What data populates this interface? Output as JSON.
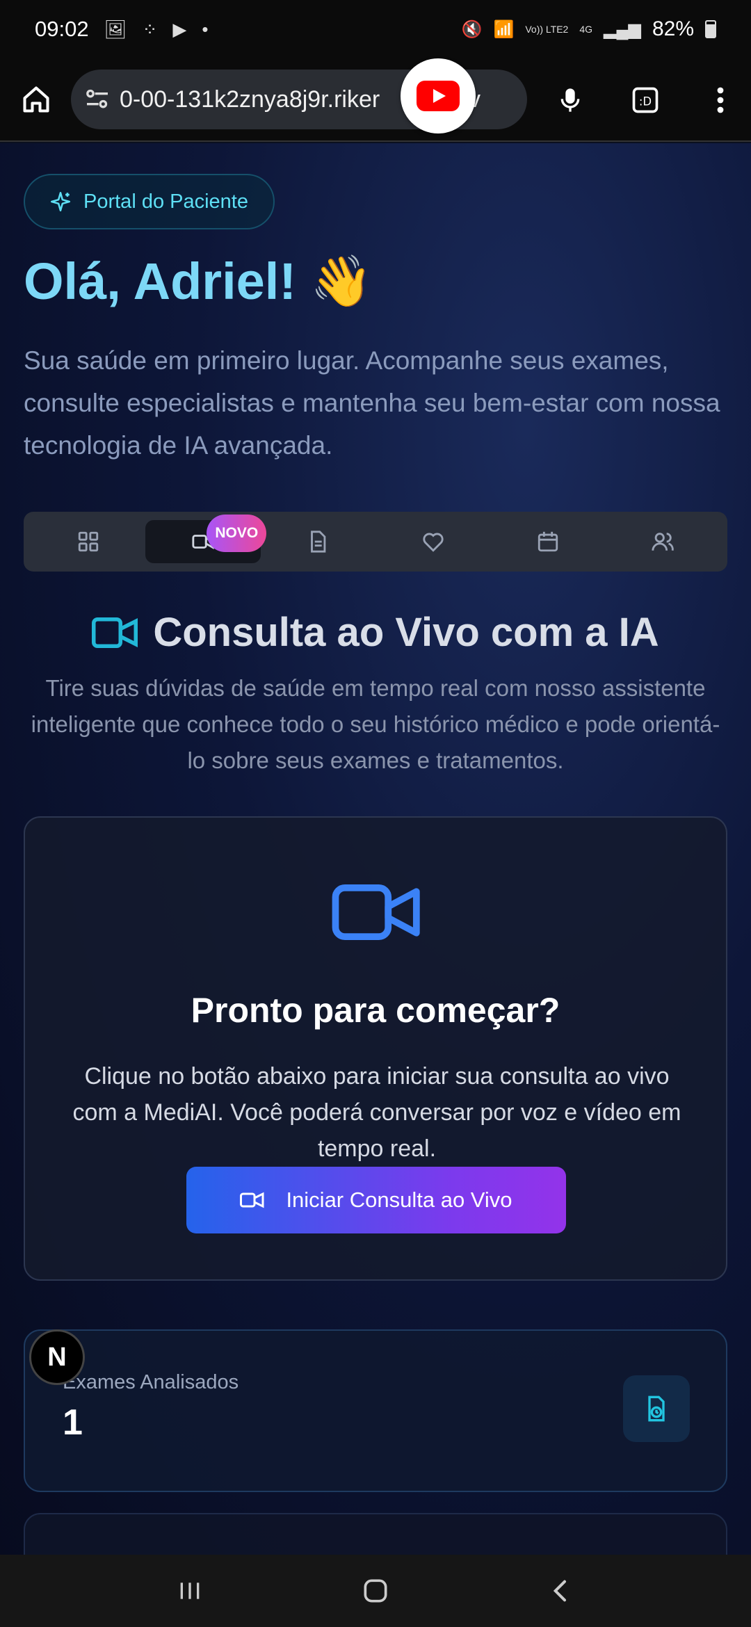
{
  "status_bar": {
    "time": "09:02",
    "battery": "82%",
    "icons": [
      "gallery-icon",
      "dots-icon",
      "youtube-icon",
      "dot-icon",
      "mute-icon",
      "wifi-icon",
      "volte-icon",
      "signal-icon",
      "battery-icon"
    ],
    "network_label": "Vo)) LTE2",
    "network_gen": "4G"
  },
  "browser": {
    "url": "0-00-131k2znya8j9r.riker",
    "url_tail": "dev"
  },
  "portal": {
    "badge": "Portal do Paciente"
  },
  "hero": {
    "greeting": "Olá, Adriel!",
    "wave_emoji": "👋",
    "intro": "Sua saúde em primeiro lugar. Acompanhe seus exames, consulte especialistas e mantenha seu bem-estar com nossa tecnologia de IA avançada."
  },
  "tabs": {
    "items": [
      "grid-icon",
      "video-icon",
      "document-icon",
      "heart-icon",
      "calendar-icon",
      "users-icon"
    ],
    "active_index": 1,
    "new_badge": "NOVO"
  },
  "section": {
    "title": "Consulta ao Vivo com a IA",
    "description": "Tire suas dúvidas de saúde em tempo real com nosso assistente inteligente que conhece todo o seu histórico médico e pode orientá-lo sobre seus exames e tratamentos."
  },
  "card": {
    "title": "Pronto para começar?",
    "text": "Clique no botão abaixo para iniciar sua consulta ao vivo com a MediAI. Você poderá conversar por voz e vídeo em tempo real.",
    "button_label": "Iniciar Consulta ao Vivo"
  },
  "stats": {
    "label": "Exames Analisados",
    "value": "1"
  },
  "floating_badge": "N",
  "colors": {
    "accent_cyan": "#7dd8f7",
    "accent_blue": "#2563eb",
    "accent_purple": "#9333ea"
  }
}
